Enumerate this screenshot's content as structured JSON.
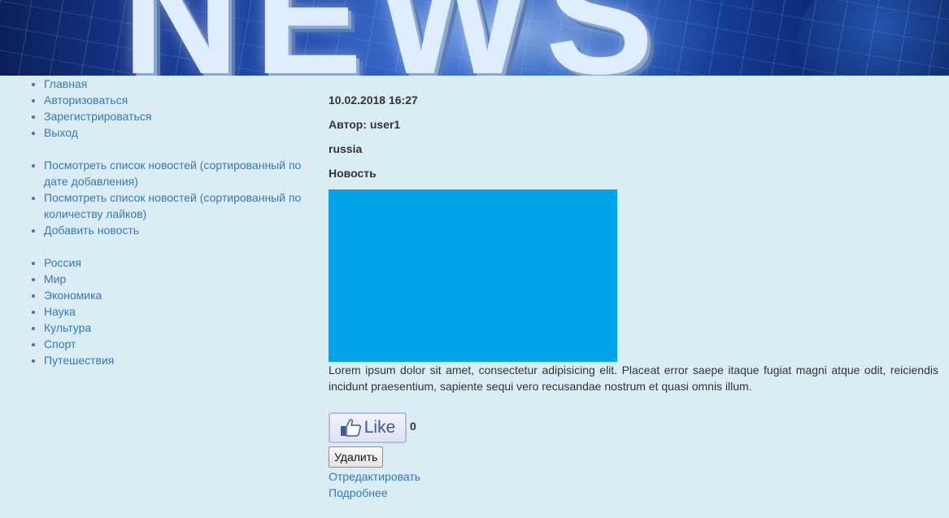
{
  "banner": {
    "logo_text": "NEWS"
  },
  "sidebar": {
    "nav_main": [
      {
        "label": "Главная"
      },
      {
        "label": "Авторизоваться"
      },
      {
        "label": "Зарегистрироваться"
      },
      {
        "label": "Выход"
      }
    ],
    "nav_news": [
      {
        "label": "Посмотреть список новостей (сортированный по дате добавления)"
      },
      {
        "label": "Посмотреть список новостей (сортированный по количеству лайков)"
      },
      {
        "label": "Добавить новость"
      }
    ],
    "categories": [
      {
        "label": "Россия"
      },
      {
        "label": "Мир"
      },
      {
        "label": "Экономика"
      },
      {
        "label": "Наука"
      },
      {
        "label": "Культура"
      },
      {
        "label": "Спорт"
      },
      {
        "label": "Путешествия"
      }
    ]
  },
  "article": {
    "date": "10.02.2018 16:27",
    "author": "Автор: user1",
    "category": "russia",
    "title": "Новость",
    "image_color": "#00a2e8",
    "body": "Lorem ipsum dolor sit amet, consectetur adipisicing elit. Placeat error saepe itaque fugiat magni atque odit, reiciendis incidunt praesentium, sapiente sequi vero recusandae nostrum et quasi omnis illum.",
    "like_label": "Like",
    "like_icon": "thumbs-up-icon",
    "like_count": "0",
    "delete_label": "Удалить",
    "edit_label": "Отредактировать",
    "more_label": "Подробнее"
  },
  "colors": {
    "page_background": "#daedf5",
    "link": "#337ab7",
    "text": "#333333"
  }
}
